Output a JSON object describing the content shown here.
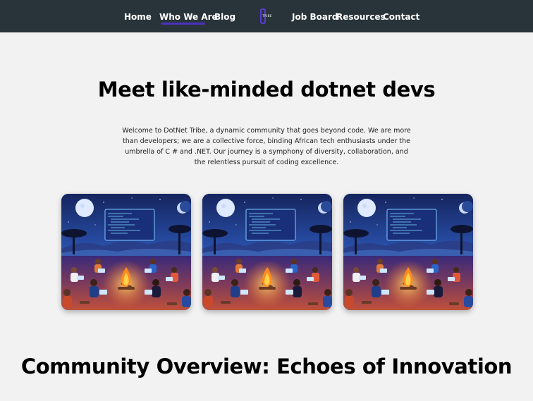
{
  "nav": {
    "home": "Home",
    "who_we_are": "Who We Are",
    "blog": "Blog",
    "job_board": "Job Board",
    "resources": "Resources",
    "contact": "Contact",
    "logo_text": "TRIBE",
    "active_color": "#4b32c3",
    "bar_color": "#28343a"
  },
  "hero": {
    "title": "Meet like-minded dotnet devs",
    "intro": "Welcome to DotNet Tribe, a dynamic community that goes beyond code. We are more than developers; we are a collective force, binding African tech enthusiasts under the umbrella of C # and .NET. Our journey is a symphony of diversity, collaboration, and the relentless pursuit of coding excellence."
  },
  "gallery": {
    "cards": [
      {
        "icon": "campfire-coders-illustration"
      },
      {
        "icon": "campfire-coders-illustration"
      },
      {
        "icon": "campfire-coders-illustration"
      }
    ]
  },
  "overview": {
    "title": "Community Overview: Echoes of Innovation"
  }
}
